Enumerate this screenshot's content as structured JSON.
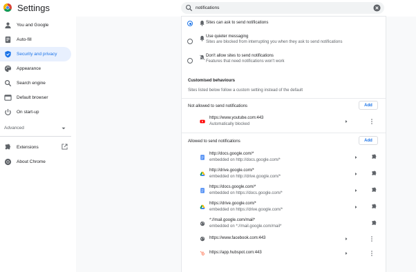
{
  "header": {
    "title": "Settings",
    "search_value": "notifications"
  },
  "sidebar": {
    "items": [
      {
        "label": "You and Google",
        "icon": "person-icon"
      },
      {
        "label": "Auto-fill",
        "icon": "autofill-icon"
      },
      {
        "label": "Security and privacy",
        "icon": "shield-icon"
      },
      {
        "label": "Appearance",
        "icon": "palette-icon"
      },
      {
        "label": "Search engine",
        "icon": "search-icon"
      },
      {
        "label": "Default browser",
        "icon": "browser-icon"
      },
      {
        "label": "On start-up",
        "icon": "power-icon"
      }
    ],
    "advanced_label": "Advanced",
    "bottom_items": [
      {
        "label": "Extensions",
        "icon": "puzzle-icon"
      },
      {
        "label": "About Chrome",
        "icon": "chrome-icon"
      }
    ]
  },
  "defaults": {
    "options": [
      {
        "title": "Sites can ask to send notifications",
        "desc": "",
        "selected": true
      },
      {
        "title": "Use quieter messaging",
        "desc": "Sites are blocked from interrupting you when they ask to send notifications",
        "selected": false
      },
      {
        "title": "Don't allow sites to send notifications",
        "desc": "Features that need notifications won't work",
        "selected": false
      }
    ]
  },
  "custom": {
    "title": "Customised behaviours",
    "subtitle": "Sites listed below follow a custom setting instead of the default",
    "blocked_label": "Not allowed to send notifications",
    "allowed_label": "Allowed to send notifications",
    "add_label": "Add",
    "blocked": [
      {
        "url": "https://www.youtube.com:443",
        "sub": "Automatically blocked"
      }
    ],
    "allowed": [
      {
        "url": "http://docs.google.com/*",
        "sub": "embedded on http://docs.google.com/*"
      },
      {
        "url": "http://drive.google.com/*",
        "sub": "embedded on http://drive.google.com/*"
      },
      {
        "url": "https://docs.google.com/*",
        "sub": "embedded on https://docs.google.com/*"
      },
      {
        "url": "https://drive.google.com/*",
        "sub": "embedded on https://drive.google.com/*"
      },
      {
        "url": "*://mail.google.com/mail*",
        "sub": "embedded on *://mail.google.com/mail*"
      },
      {
        "url": "https://www.facebook.com:443",
        "sub": ""
      },
      {
        "url": "https://app.hubspot.com:443",
        "sub": ""
      }
    ]
  },
  "colors": {
    "accent": "#1a73e8",
    "active_bg": "#e8f0fe",
    "page_bg": "#f8f9fa"
  }
}
